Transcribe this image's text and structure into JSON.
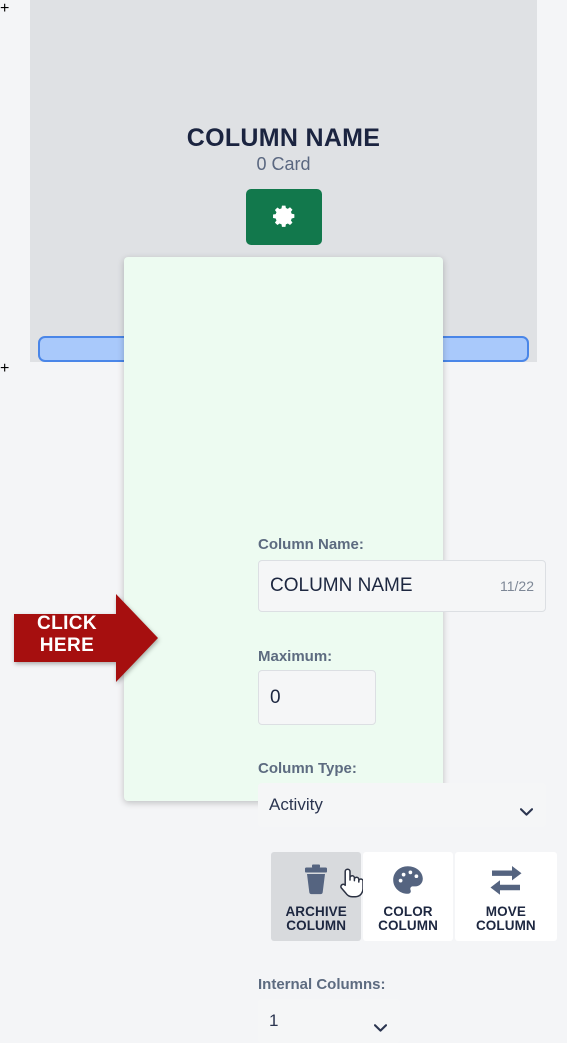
{
  "board": {
    "column": {
      "title": "COLUMN NAME",
      "card_count_label": "0 Card"
    },
    "add_column_left_label": "+",
    "add_column_right_label": "+",
    "settings_icon": "gear-icon"
  },
  "settings_panel": {
    "column_name": {
      "label": "Column Name:",
      "value": "COLUMN NAME",
      "placeholder": "Column Name",
      "counter": "11/22"
    },
    "maximum": {
      "label": "Maximum:",
      "value": "0",
      "placeholder": "0"
    },
    "column_type": {
      "label": "Column Type:",
      "selected": "Activity",
      "options": [
        "Activity"
      ],
      "chevron_icon": "chevron-down-icon"
    },
    "actions": [
      {
        "id": "archive-column",
        "label": "ARCHIVE\nCOLUMN",
        "icon": "trash-icon",
        "active": true
      },
      {
        "id": "color-column",
        "label": "COLOR\nCOLUMN",
        "icon": "palette-icon",
        "active": false
      },
      {
        "id": "move-column",
        "label": "MOVE\nCOLUMN",
        "icon": "move-arrows-icon",
        "active": false
      }
    ],
    "internal_columns": {
      "label": "Internal Columns:",
      "selected": "1",
      "options": [
        "1"
      ],
      "chevron_icon": "chevron-down-icon"
    }
  },
  "annotation": {
    "click_here_text": "CLICK\nHERE",
    "arrow_color": "#a60f0f"
  },
  "colors": {
    "accent_green": "#12784c",
    "add_strip_fill": "#a9c9fb",
    "add_strip_border": "#4a86e8",
    "panel_bg": "#edfbf1",
    "column_bg": "#dfe1e4",
    "page_bg": "#f4f5f7",
    "icon_slate": "#556480",
    "title_navy": "#1b2440"
  }
}
